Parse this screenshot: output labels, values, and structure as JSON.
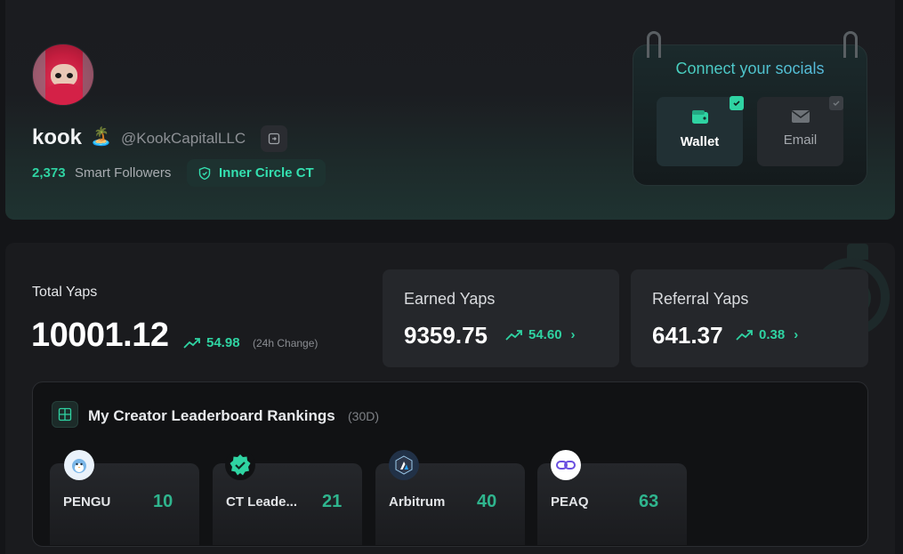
{
  "profile": {
    "name": "kook",
    "name_emoji": "🏝️",
    "handle": "@KookCapitalLLC",
    "smart_followers_count": "2,373",
    "smart_followers_label": "Smart Followers",
    "badge_label": "Inner Circle CT"
  },
  "socials": {
    "title": "Connect your socials",
    "buttons": [
      {
        "label": "Wallet",
        "icon": "wallet-icon",
        "connected": true
      },
      {
        "label": "Email",
        "icon": "mail-icon",
        "connected": false
      }
    ]
  },
  "yaps": {
    "total": {
      "label": "Total Yaps",
      "value": "10001.12",
      "change": "54.98",
      "change_note": "(24h Change)"
    },
    "earned": {
      "label": "Earned Yaps",
      "value": "9359.75",
      "change": "54.60"
    },
    "referral": {
      "label": "Referral Yaps",
      "value": "641.37",
      "change": "0.38"
    }
  },
  "rankings": {
    "title": "My Creator Leaderboard Rankings",
    "period": "(30D)",
    "items": [
      {
        "name": "PENGU",
        "rank": "10",
        "icon": "pengu-logo-icon"
      },
      {
        "name": "CT Leade...",
        "rank": "21",
        "icon": "verified-badge-icon"
      },
      {
        "name": "Arbitrum",
        "rank": "40",
        "icon": "arbitrum-logo-icon"
      },
      {
        "name": "PEAQ",
        "rank": "63",
        "icon": "peaq-logo-icon"
      }
    ]
  },
  "colors": {
    "accent": "#2fd3a2",
    "background": "#141518",
    "card": "#25272b"
  }
}
